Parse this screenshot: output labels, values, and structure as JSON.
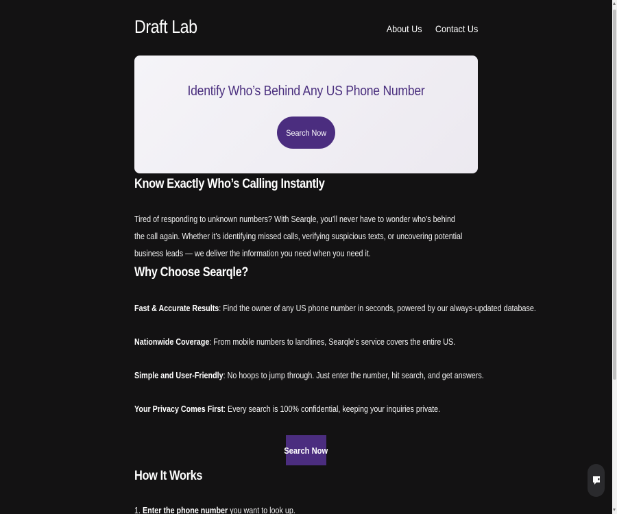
{
  "header": {
    "logo": "Draft Lab",
    "nav": [
      "About Us",
      "Contact Us"
    ]
  },
  "hero": {
    "title": "Identify Who’s Behind Any US Phone Number",
    "button": "Search Now"
  },
  "intro": {
    "heading": "Know Exactly Who’s Calling Instantly",
    "paragraph": "Tired of responding to unknown numbers? With Searqle, you’ll never have to wonder who’s behind the call again. Whether it’s identifying missed calls, verifying suspicious texts, or uncovering potential business leads — we deliver the information you need when you need it."
  },
  "why": {
    "heading": "Why Choose Searqle?",
    "features": [
      {
        "title": "Fast & Accurate Results",
        "text": ": Find the owner of any US phone number in seconds, powered by our always-updated database."
      },
      {
        "title": "Nationwide Coverage",
        "text": ": From mobile numbers to landlines, Searqle’s service covers the entire US."
      },
      {
        "title": "Simple and User-Friendly",
        "text": ": No hoops to jump through. Just enter the number, hit search, and get answers."
      },
      {
        "title": "Your Privacy Comes First",
        "text": ": Every search is 100% confidential, keeping your inquiries private."
      }
    ],
    "button": "Search Now"
  },
  "how": {
    "heading": "How It Works",
    "steps": [
      {
        "num": "1.",
        "title": "Enter the phone number",
        "text": " you want to look up."
      }
    ]
  },
  "icons": {
    "chat": "chat-icon"
  },
  "colors": {
    "background": "#131213",
    "accent": "#4b2d7f",
    "hero_title": "#4a2f7e"
  }
}
